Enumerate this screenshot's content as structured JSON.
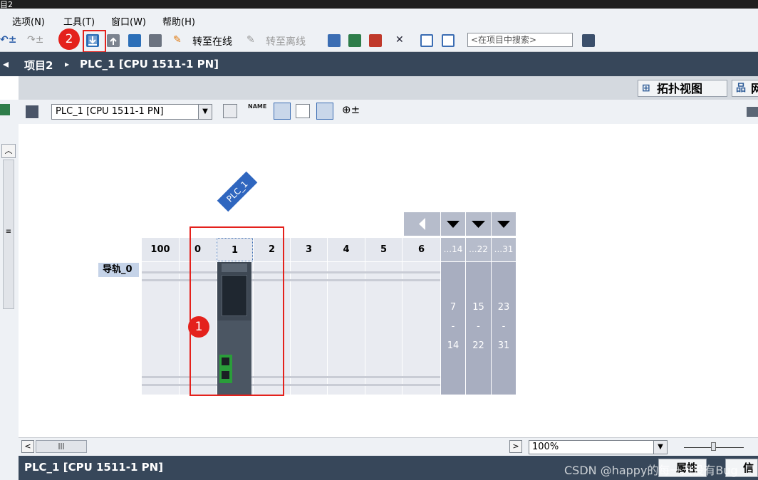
{
  "window": {
    "title": "目2"
  },
  "menu": [
    "选项(N)",
    "工具(T)",
    "窗口(W)",
    "帮助(H)"
  ],
  "toolbar": {
    "go_online": "转至在线",
    "go_offline": "转至离线",
    "search_placeholder": "<在项目中搜索>"
  },
  "breadcrumb": {
    "project": "项目2",
    "separator": "▸",
    "device": "PLC_1 [CPU 1511-1 PN]"
  },
  "view_tabs": {
    "topology": "拓扑视图",
    "network": "网"
  },
  "device_toolbar": {
    "selected_device": "PLC_1 [CPU 1511-1 PN]",
    "name_btn": "NAME"
  },
  "plc_tag": "PLC_1",
  "rail": {
    "label": "导轨_0",
    "slots": [
      "100",
      "0",
      "1",
      "2",
      "3",
      "4",
      "5",
      "6"
    ],
    "extra_slots": [
      "...14",
      "...22",
      "...31"
    ],
    "extra_ranges": [
      [
        "7",
        "-",
        "14"
      ],
      [
        "15",
        "-",
        "22"
      ],
      [
        "23",
        "-",
        "31"
      ]
    ]
  },
  "annotations": {
    "badge1": "1",
    "badge2": "2"
  },
  "zoom": {
    "value": "100%"
  },
  "bottom": {
    "device": "PLC_1 [CPU 1511-1 PN]",
    "properties": "属性",
    "info": "信"
  },
  "watermark": "CSDN @happy的每一天没有Bug"
}
